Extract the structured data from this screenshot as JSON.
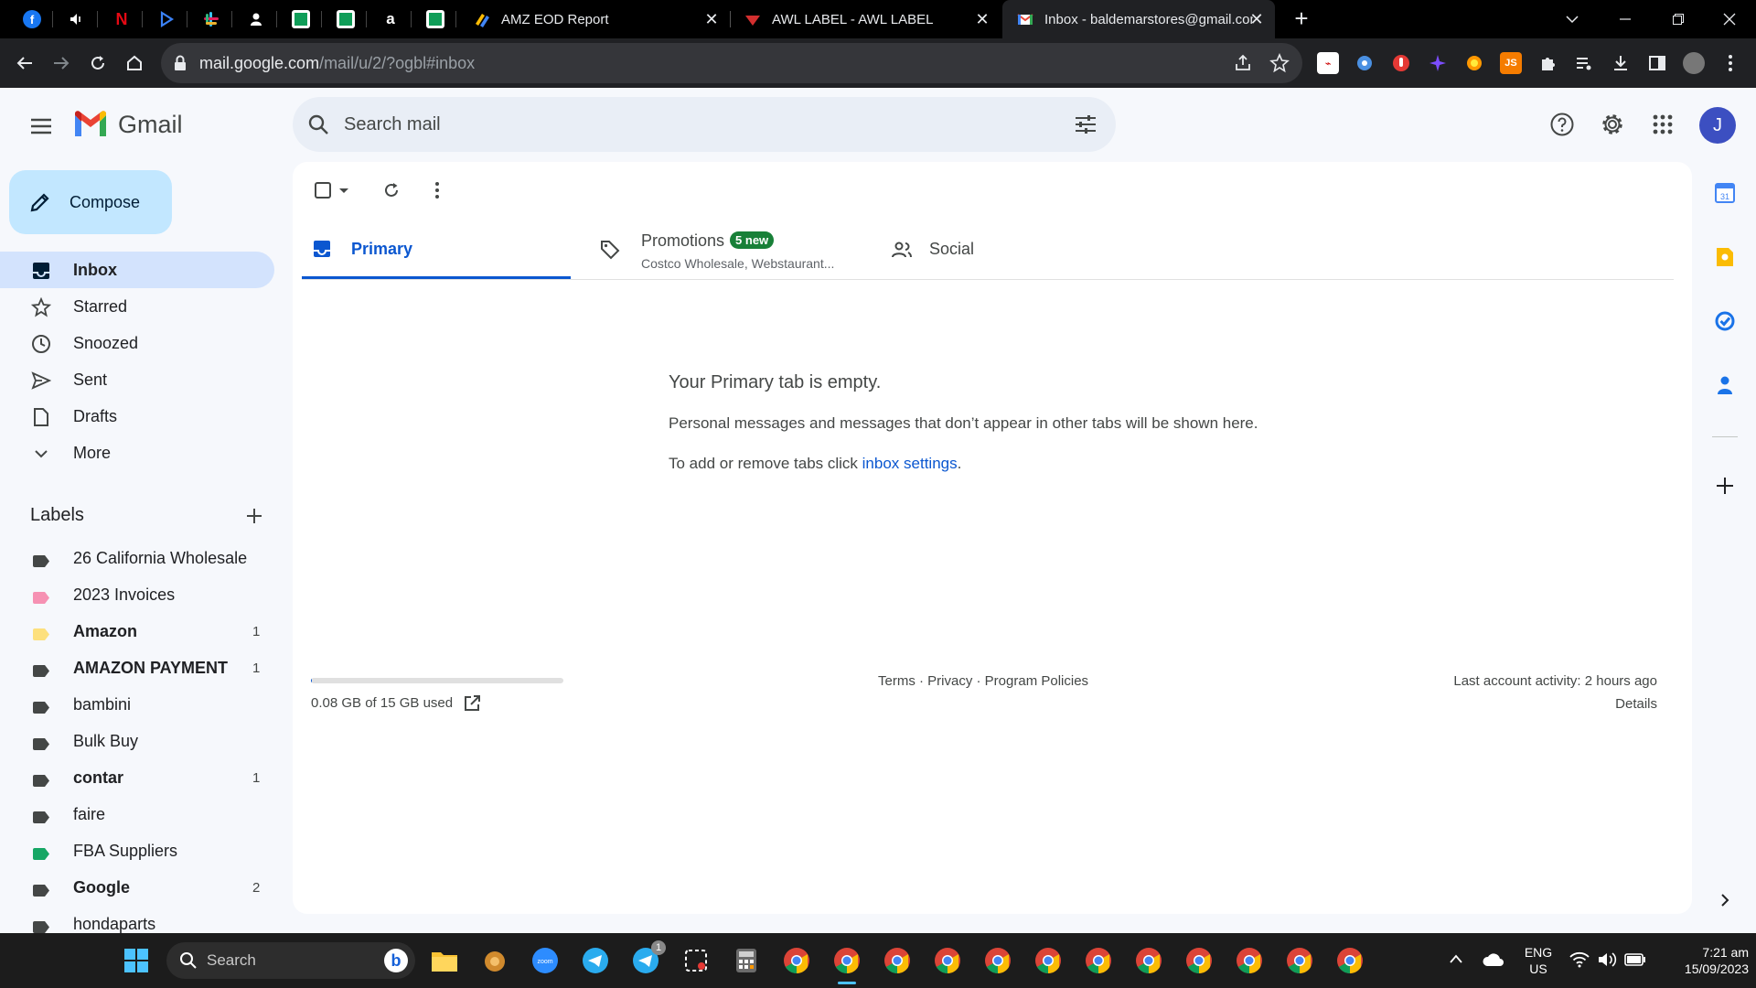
{
  "browser": {
    "pinned_tabs": [
      {
        "icon": "facebook-icon",
        "glyph": "f",
        "color": "#1877f2"
      },
      {
        "icon": "speaker-icon",
        "glyph": "",
        "color": "#000000"
      },
      {
        "icon": "netflix-icon",
        "glyph": "N",
        "color": "#000000"
      },
      {
        "icon": "play-icon",
        "glyph": "",
        "color": "#000000"
      },
      {
        "icon": "slack-icon",
        "glyph": "",
        "color": "#000000"
      },
      {
        "icon": "person-icon",
        "glyph": "",
        "color": "#000000"
      },
      {
        "icon": "sheets-icon",
        "glyph": "",
        "color": "#0f9d58"
      },
      {
        "icon": "sheets-icon",
        "glyph": "",
        "color": "#0f9d58"
      },
      {
        "icon": "amazon-icon",
        "glyph": "a",
        "color": "#000000"
      },
      {
        "icon": "sheets-icon",
        "glyph": "",
        "color": "#0f9d58"
      }
    ],
    "tabs": [
      {
        "title": "AMZ EOD Report",
        "active": false
      },
      {
        "title": "AWL LABEL - AWL LABEL",
        "active": false
      },
      {
        "title": "Inbox - baldemarstores@gmail.com",
        "active": true
      }
    ],
    "url_host": "mail.google.com",
    "url_path": "/mail/u/2/?ogbl#inbox"
  },
  "gmail": {
    "brand": "Gmail",
    "search_placeholder": "Search mail",
    "avatar_letter": "J",
    "compose_label": "Compose",
    "nav": [
      {
        "label": "Inbox",
        "icon": "inbox-icon",
        "active": true
      },
      {
        "label": "Starred",
        "icon": "star-icon",
        "active": false
      },
      {
        "label": "Snoozed",
        "icon": "clock-icon",
        "active": false
      },
      {
        "label": "Sent",
        "icon": "send-icon",
        "active": false
      },
      {
        "label": "Drafts",
        "icon": "draft-icon",
        "active": false
      },
      {
        "label": "More",
        "icon": "chevron-down-icon",
        "active": false
      }
    ],
    "labels_heading": "Labels",
    "labels": [
      {
        "name": "26 California Wholesale",
        "count": "",
        "color": "#444746",
        "bold": false
      },
      {
        "name": "2023 Invoices",
        "count": "",
        "color": "#f691b3",
        "bold": false
      },
      {
        "name": "Amazon",
        "count": "1",
        "color": "#fde07d",
        "bold": true
      },
      {
        "name": "AMAZON PAYMENT",
        "count": "1",
        "color": "#444746",
        "bold": true
      },
      {
        "name": "bambini",
        "count": "",
        "color": "#444746",
        "bold": false
      },
      {
        "name": "Bulk Buy",
        "count": "",
        "color": "#444746",
        "bold": false
      },
      {
        "name": "contar",
        "count": "1",
        "color": "#444746",
        "bold": true
      },
      {
        "name": "faire",
        "count": "",
        "color": "#444746",
        "bold": false
      },
      {
        "name": "FBA Suppliers",
        "count": "",
        "color": "#16a765",
        "bold": false
      },
      {
        "name": "Google",
        "count": "2",
        "color": "#444746",
        "bold": true
      },
      {
        "name": "hondaparts",
        "count": "",
        "color": "#444746",
        "bold": false
      }
    ],
    "categories": {
      "primary": "Primary",
      "promotions": "Promotions",
      "promotions_badge": "5 new",
      "promotions_sub": "Costco Wholesale, Webstaurant...",
      "social": "Social"
    },
    "empty": {
      "title": "Your Primary tab is empty.",
      "line1": "Personal messages and messages that don’t appear in other tabs will be shown here.",
      "line2_prefix": "To add or remove tabs click ",
      "line2_link": "inbox settings",
      "line2_suffix": "."
    },
    "footer": {
      "storage": "0.08 GB of 15 GB used",
      "storage_fraction": 0.005,
      "links": "Terms · Privacy · Program Policies",
      "activity": "Last account activity: 2 hours ago",
      "details": "Details"
    },
    "accent": "#0b57d0"
  },
  "taskbar": {
    "search_label": "Search",
    "lang_top": "ENG",
    "lang_bottom": "US",
    "time": "7:21 am",
    "date": "15/09/2023",
    "telegram_badge": "1"
  }
}
